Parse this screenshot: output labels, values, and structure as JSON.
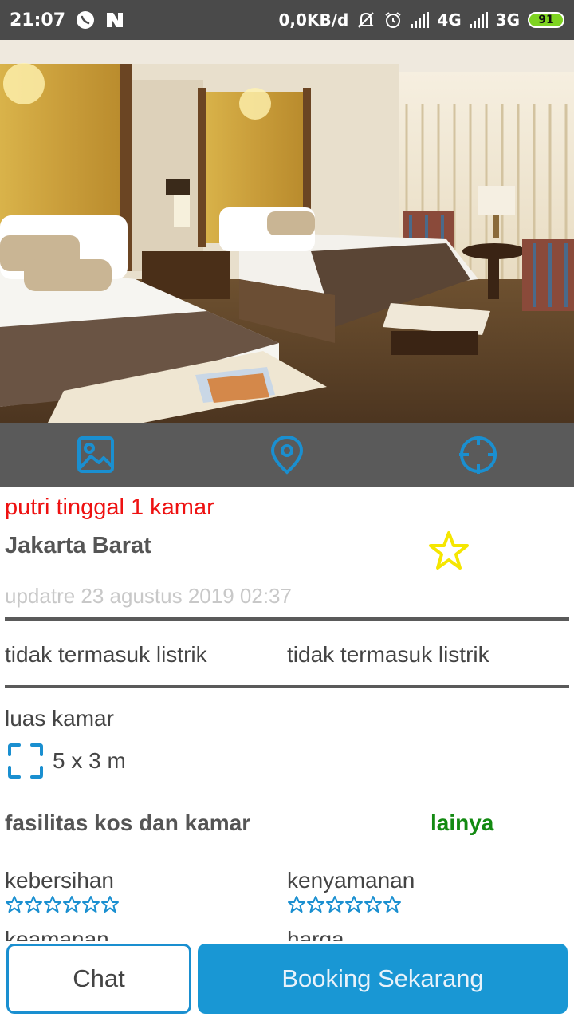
{
  "status_bar": {
    "time": "21:07",
    "data_rate": "0,0KB/d",
    "network_1": "4G",
    "network_2": "3G",
    "battery": "91"
  },
  "hero": {
    "image_icon": "hotel-room-photo"
  },
  "action_bar": {
    "buttons": [
      {
        "icon": "image-icon"
      },
      {
        "icon": "location-pin-icon"
      },
      {
        "icon": "crosshair-icon"
      }
    ],
    "icon_color": "#1a8fd0"
  },
  "listing": {
    "title": "putri tinggal 1 kamar",
    "location": "Jakarta Barat",
    "updated": "updatre 23 agustus 2019 02:37",
    "info_left": "tidak termasuk listrik",
    "info_right": "tidak termasuk listrik",
    "room_size_label": "luas kamar",
    "room_size_value": "5 x 3 m",
    "facilities_label": "fasilitas kos dan kamar",
    "facilities_more": "lainya",
    "ratings": [
      {
        "label": "kebersihan",
        "stars": 0
      },
      {
        "label": "kenyamanan",
        "stars": 0
      }
    ],
    "ratings_cut": [
      {
        "label": "keamanan"
      },
      {
        "label": "harga"
      }
    ]
  },
  "colors": {
    "title": "#ee1111",
    "accent": "#1a8fd0",
    "star_fav": "#f5e600",
    "lainya": "#138a12",
    "primary_button": "#1997d4"
  },
  "bottom": {
    "chat_label": "Chat",
    "booking_label": "Booking Sekarang"
  }
}
